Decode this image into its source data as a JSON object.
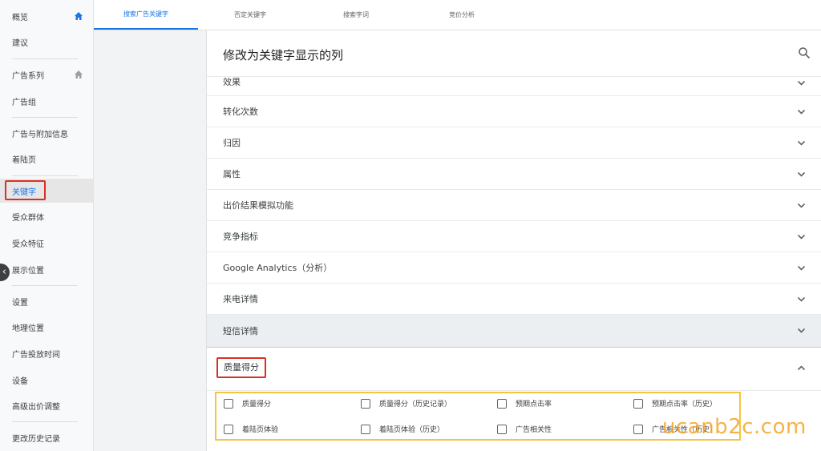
{
  "sidebar": {
    "items": [
      {
        "label": "概览"
      },
      {
        "label": "建议"
      },
      {
        "label": "广告系列"
      },
      {
        "label": "广告组"
      },
      {
        "label": "广告与附加信息"
      },
      {
        "label": "着陆页"
      },
      {
        "label": "关键字"
      },
      {
        "label": "受众群体"
      },
      {
        "label": "受众特征"
      },
      {
        "label": "展示位置"
      },
      {
        "label": "设置"
      },
      {
        "label": "地理位置"
      },
      {
        "label": "广告投放时间"
      },
      {
        "label": "设备"
      },
      {
        "label": "高级出价调整"
      },
      {
        "label": "更改历史记录"
      }
    ],
    "active_item": "关键字",
    "collapse_glyph": "‹",
    "accent": "#1a73e8"
  },
  "tabs": [
    {
      "label": "搜索广告关键字",
      "active": true
    },
    {
      "label": "否定关键字"
    },
    {
      "label": "搜索字词"
    },
    {
      "label": "竞价分析"
    }
  ],
  "panel": {
    "title": "修改为关键字显示的列",
    "search_icon": "search-icon",
    "sections": [
      {
        "label": "效果"
      },
      {
        "label": "转化次数"
      },
      {
        "label": "归因"
      },
      {
        "label": "属性"
      },
      {
        "label": "出价结果模拟功能"
      },
      {
        "label": "竞争指标"
      },
      {
        "label": "Google Analytics（分析）"
      },
      {
        "label": "来电详情"
      },
      {
        "label": "短信详情"
      }
    ],
    "expanded_section": {
      "label": "质量得分",
      "options": [
        {
          "label": "质量得分",
          "checked": false
        },
        {
          "label": "质量得分（历史记录）",
          "checked": false
        },
        {
          "label": "预期点击率",
          "checked": false
        },
        {
          "label": "预期点击率（历史）",
          "checked": false
        },
        {
          "label": "着陆页体验",
          "checked": false
        },
        {
          "label": "着陆页体验（历史）",
          "checked": false
        },
        {
          "label": "广告相关性",
          "checked": false
        },
        {
          "label": "广告相关性（历史）",
          "checked": false
        }
      ]
    }
  },
  "watermark": "ucanb2c.com",
  "colors": {
    "highlight_red": "#d93025",
    "highlight_yellow": "#f4c542",
    "tab_active": "#1a73e8"
  }
}
